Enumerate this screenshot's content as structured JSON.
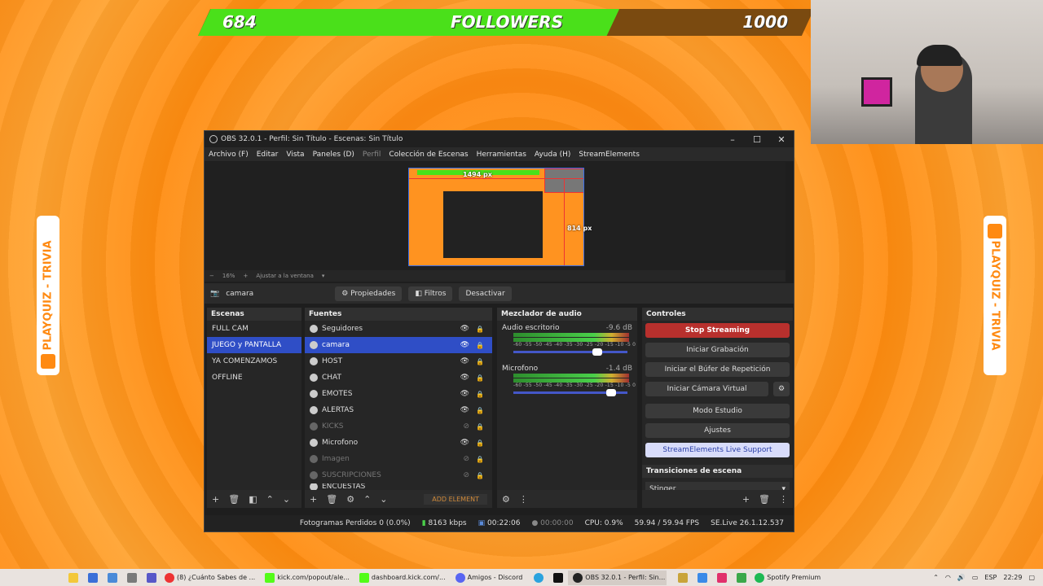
{
  "overlay": {
    "followers_current": "684",
    "followers_label": "FOLLOWERS",
    "followers_goal": "1000",
    "followers_progress": 0.684,
    "side_banner_text": "PLAYQUIZ - TRIVIA"
  },
  "window": {
    "title": "OBS 32.0.1 - Perfil: Sin Título - Escenas: Sin Título",
    "controls": [
      "–",
      "☐",
      "✕"
    ]
  },
  "menu": [
    "Archivo (F)",
    "Editar",
    "Vista",
    "Paneles (D)",
    "Perfil",
    "Colección de Escenas",
    "Herramientas",
    "Ayuda (H)",
    "StreamElements"
  ],
  "preview": {
    "width_label": "1494 px",
    "height_label": "814 px",
    "zoom": "16%",
    "fit_label": "Ajustar a la ventana"
  },
  "source_bar": {
    "selected_source": "camara",
    "properties_label": "Propiedades",
    "filters_label": "Filtros",
    "deactivate_label": "Desactivar"
  },
  "scenes": {
    "header": "Escenas",
    "items": [
      "FULL CAM",
      "JUEGO y PANTALLA",
      "YA COMENZAMOS",
      "OFFLINE"
    ],
    "selected": "JUEGO y PANTALLA"
  },
  "sources": {
    "header": "Fuentes",
    "items": [
      {
        "name": "Seguidores",
        "visible": true
      },
      {
        "name": "camara",
        "visible": true,
        "selected": true
      },
      {
        "name": "HOST",
        "visible": true
      },
      {
        "name": "CHAT",
        "visible": true
      },
      {
        "name": "EMOTES",
        "visible": true
      },
      {
        "name": "ALERTAS",
        "visible": true
      },
      {
        "name": "KICKS",
        "visible": false
      },
      {
        "name": "Microfono",
        "visible": true
      },
      {
        "name": "Imagen",
        "visible": false
      },
      {
        "name": "SUSCRIPCIONES",
        "visible": false
      },
      {
        "name": "ENCUESTAS",
        "visible": true
      }
    ],
    "add_element_label": "ADD ELEMENT"
  },
  "mixer": {
    "header": "Mezclador de audio",
    "scale": "-60 -55 -50 -45 -40 -35 -30 -25 -20 -15 -10 -5 0",
    "channels": [
      {
        "name": "Audio escritorio",
        "db": "-9.6 dB",
        "level": 0.78
      },
      {
        "name": "Microfono",
        "db": "-1.4 dB",
        "level": 0.9
      }
    ]
  },
  "controls": {
    "header": "Controles",
    "stop_streaming": "Stop Streaming",
    "start_recording": "Iniciar Grabación",
    "start_replay": "Iniciar el Búfer de Repetición",
    "start_virtual_cam": "Iniciar Cámara Virtual",
    "studio_mode": "Modo Estudio",
    "settings": "Ajustes",
    "se_support": "StreamElements Live Support"
  },
  "transitions": {
    "header": "Transiciones de escena",
    "selected": "Stinger"
  },
  "status": {
    "dropped_frames": "Fotogramas Perdidos 0 (0.0%)",
    "bitrate": "8163 kbps",
    "stream_time": "00:22:06",
    "rec_time": "00:00:00",
    "cpu": "CPU: 0.9%",
    "fps": "59.94 / 59.94 FPS",
    "se_version": "SE.Live 26.1.12.537"
  },
  "taskbar": {
    "apps": [
      "(8) ¿Cuánto Sabes de ...",
      "kick.com/popout/ale...",
      "dashboard.kick.com/...",
      "Amigos - Discord",
      "OBS 32.0.1 - Perfil: Sin...",
      "Spotify Premium"
    ],
    "language": "ESP",
    "time": "22:29"
  },
  "colors": {
    "background": "#ff8c10",
    "follower_fill": "#4ae01a",
    "stop_button": "#b8302d",
    "selection": "#2f4ec6"
  }
}
